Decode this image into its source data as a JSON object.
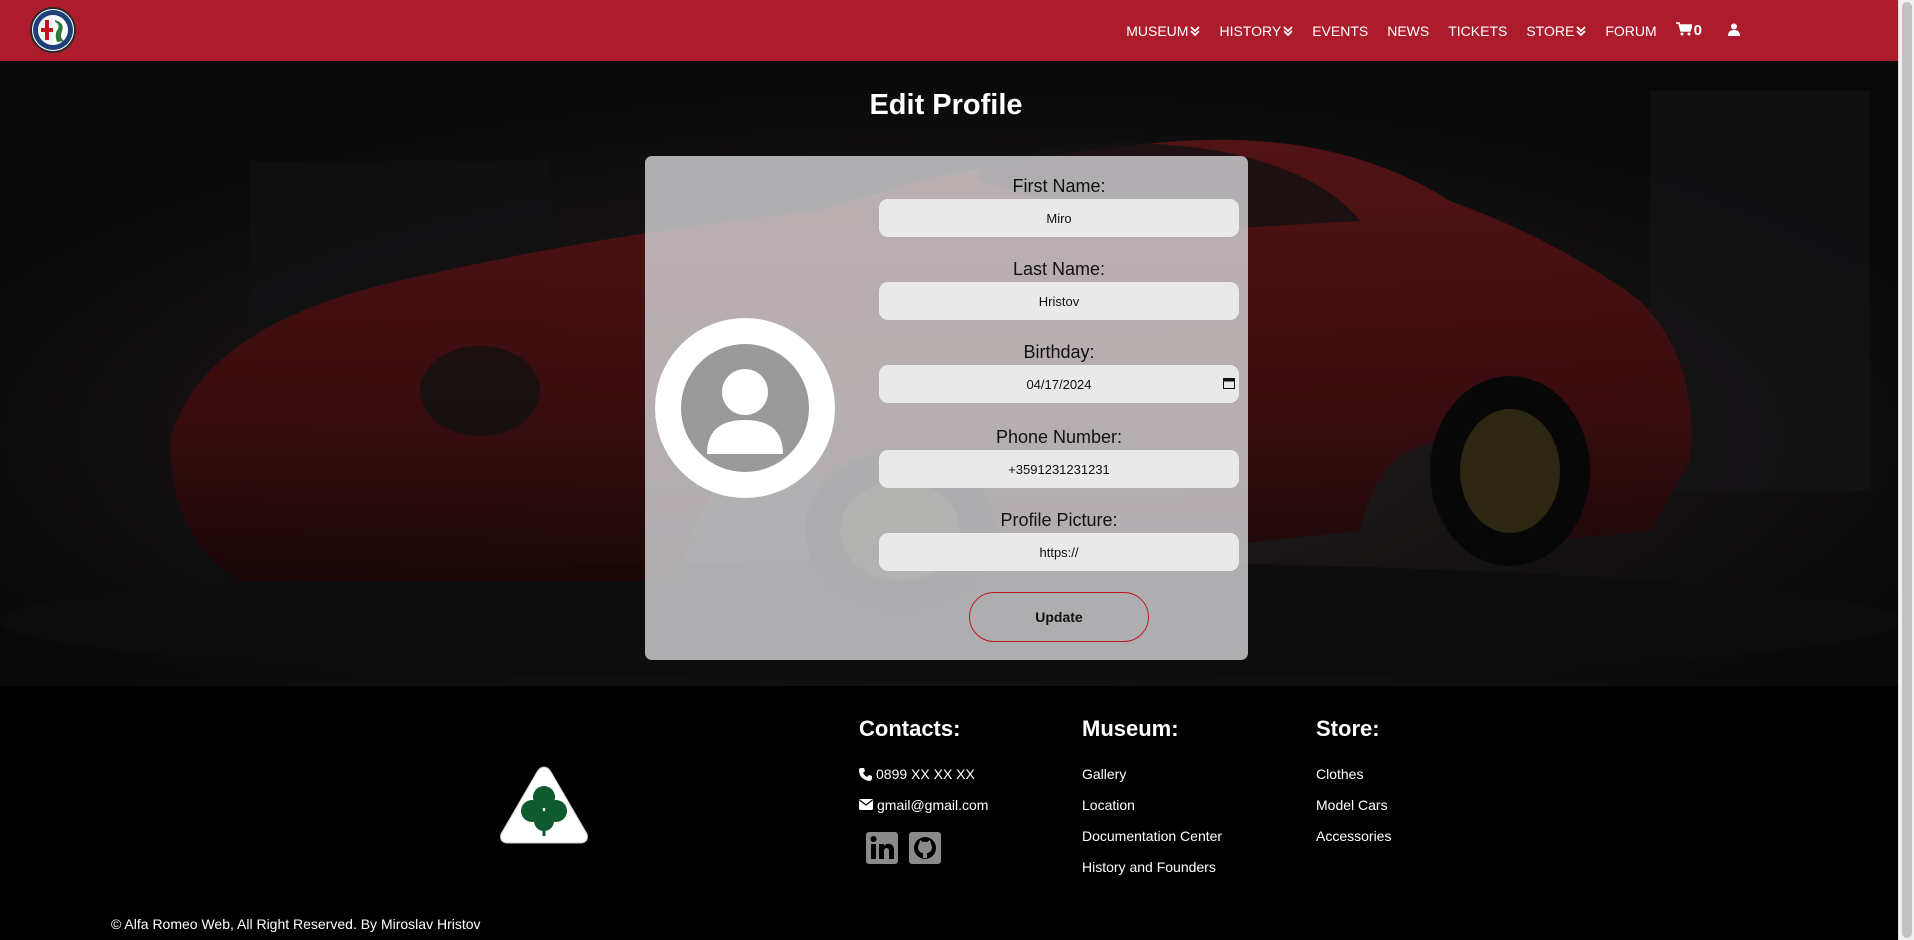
{
  "nav": {
    "items": [
      {
        "label": "MUSEUM",
        "dropdown": true
      },
      {
        "label": "HISTORY",
        "dropdown": true
      },
      {
        "label": "EVENTS",
        "dropdown": false
      },
      {
        "label": "NEWS",
        "dropdown": false
      },
      {
        "label": "TICKETS",
        "dropdown": false
      },
      {
        "label": "STORE",
        "dropdown": true
      },
      {
        "label": "FORUM",
        "dropdown": false
      }
    ],
    "cart_count": "0",
    "logo_icon": "alfa-romeo-logo",
    "cart_icon": "cart-icon",
    "user_icon": "user-icon"
  },
  "page": {
    "title": "Edit Profile"
  },
  "form": {
    "first_name_label": "First Name:",
    "first_name_value": "Miro",
    "last_name_label": "Last Name:",
    "last_name_value": "Hristov",
    "birthday_label": "Birthday:",
    "birthday_value": "04/17/2024",
    "phone_label": "Phone Number:",
    "phone_value": "+3591231231231",
    "picture_label": "Profile Picture:",
    "picture_value": "https://",
    "update_label": "Update"
  },
  "footer": {
    "contacts_title": "Contacts:",
    "phone": "0899 XX XX XX",
    "email": "gmail@gmail.com",
    "museum_title": "Museum:",
    "museum_links": [
      "Gallery",
      "Location",
      "Documentation Center",
      "History and Founders"
    ],
    "store_title": "Store:",
    "store_links": [
      "Clothes",
      "Model Cars",
      "Accessories"
    ],
    "copyright": "© Alfa Romeo Web, All Right Reserved. By Miroslav Hristov",
    "social_icons": [
      "linkedin-icon",
      "github-icon"
    ]
  },
  "colors": {
    "nav_bg": "#ad1c2c",
    "accent_red": "#c0141e",
    "card_bg": "#d2d2d4",
    "footer_bg": "#000000"
  }
}
